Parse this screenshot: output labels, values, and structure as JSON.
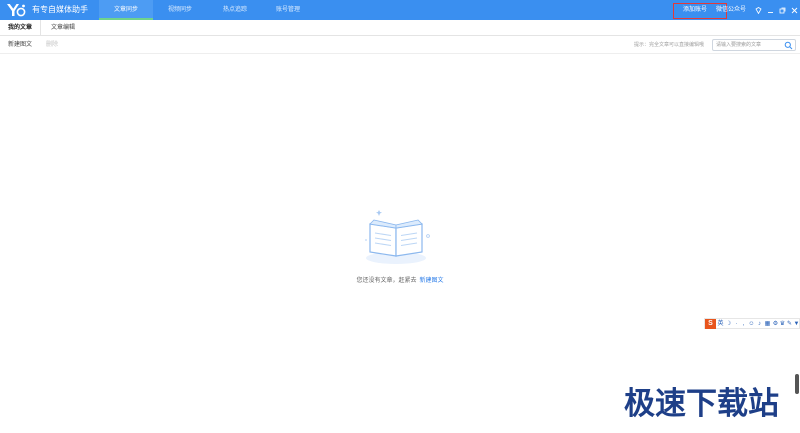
{
  "app": {
    "title": "有专自媒体助手",
    "accent_color": "#3a8ff0"
  },
  "nav": {
    "tabs": [
      {
        "label": "文章同步",
        "active": true
      },
      {
        "label": "视频同步",
        "active": false
      },
      {
        "label": "热点追踪",
        "active": false
      },
      {
        "label": "账号管理",
        "active": false
      }
    ]
  },
  "header_links": {
    "add_account": "添加账号",
    "wechat_official": "微信公众号"
  },
  "window_controls": {
    "pin": "pin-icon",
    "minimize": "minimize-icon",
    "restore": "restore-icon",
    "close": "close-icon"
  },
  "subtabs": [
    {
      "label": "我的文章",
      "active": true
    },
    {
      "label": "文章编辑",
      "active": false
    }
  ],
  "toolbar": {
    "new_article": "新建图文",
    "delete": "删除",
    "hint": "提示：完全文章可以直接编辑哦",
    "search_placeholder": "请输入要搜索的文章"
  },
  "empty_state": {
    "message": "您还没有文章，赶紧去",
    "link": "新建图文",
    "icon": "open-book-icon"
  },
  "ime_toolbar": {
    "logo": "S",
    "items": [
      "英",
      "☽",
      "·",
      ",",
      "☺",
      "♪",
      "▦",
      "⚙",
      "♛",
      "✎",
      "▼"
    ]
  },
  "watermark": {
    "text": "极速下载站"
  }
}
